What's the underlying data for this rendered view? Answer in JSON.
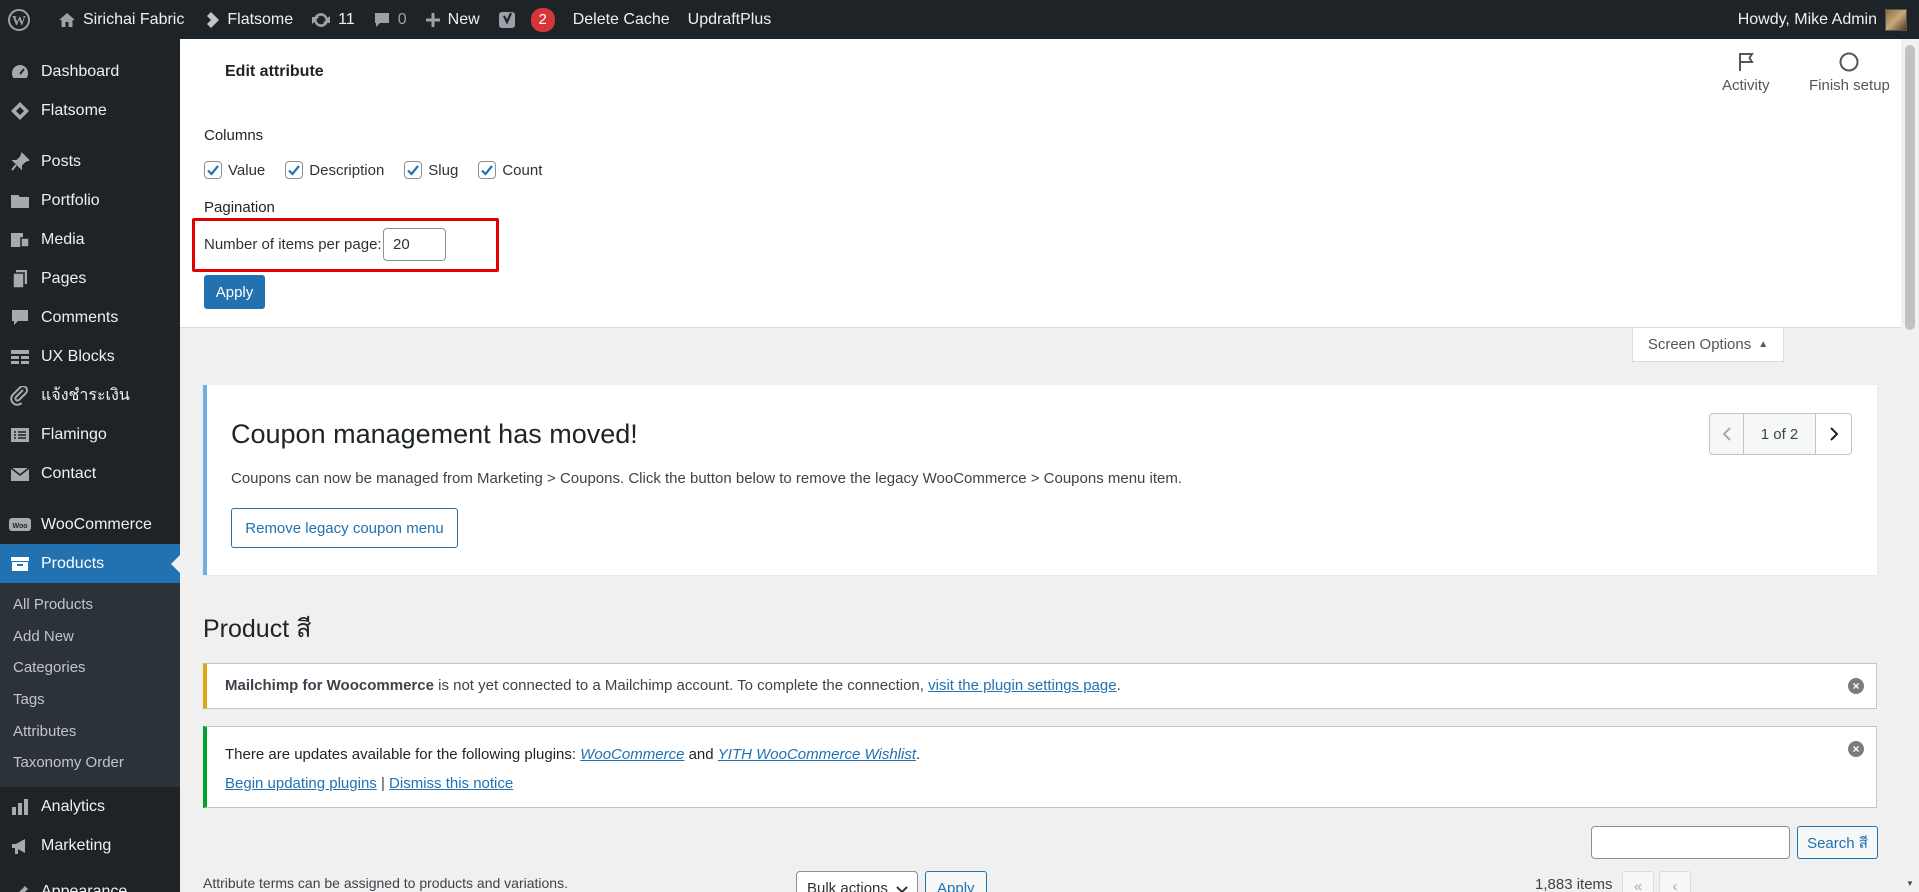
{
  "adminbar": {
    "site_name": "Sirichai Fabric",
    "theme": "Flatsome",
    "updates_count": "11",
    "comments_count": "0",
    "new_label": "New",
    "yoast_badge": "2",
    "delete_cache": "Delete Cache",
    "updraft": "UpdraftPlus",
    "howdy": "Howdy, Mike Admin"
  },
  "sidebar": {
    "items": [
      {
        "label": "Dashboard",
        "icon": "dashboard-icon"
      },
      {
        "label": "Flatsome",
        "icon": "flatsome-icon"
      },
      {
        "label": "Posts",
        "icon": "pin-icon"
      },
      {
        "label": "Portfolio",
        "icon": "folder-icon"
      },
      {
        "label": "Media",
        "icon": "media-icon"
      },
      {
        "label": "Pages",
        "icon": "pages-icon"
      },
      {
        "label": "Comments",
        "icon": "comment-icon"
      },
      {
        "label": "UX Blocks",
        "icon": "grid-icon"
      },
      {
        "label": "แจ้งชำระเงิน",
        "icon": "paperclip-icon"
      },
      {
        "label": "Flamingo",
        "icon": "list-icon"
      },
      {
        "label": "Contact",
        "icon": "mail-icon"
      },
      {
        "label": "WooCommerce",
        "icon": "woo-icon"
      },
      {
        "label": "Products",
        "icon": "archive-icon"
      },
      {
        "label": "Analytics",
        "icon": "bar-chart-icon"
      },
      {
        "label": "Marketing",
        "icon": "megaphone-icon"
      },
      {
        "label": "Appearance",
        "icon": "brush-icon"
      }
    ],
    "submenu": [
      "All Products",
      "Add New",
      "Categories",
      "Tags",
      "Attributes",
      "Taxonomy Order"
    ]
  },
  "header": {
    "title": "Edit attribute",
    "activity": "Activity",
    "finish_setup": "Finish setup"
  },
  "screen_options": {
    "columns_legend": "Columns",
    "columns": [
      "Value",
      "Description",
      "Slug",
      "Count"
    ],
    "pagination_legend": "Pagination",
    "per_page_label": "Number of items per page:",
    "per_page_value": "20",
    "apply": "Apply",
    "tab_label": "Screen Options"
  },
  "coupon_notice": {
    "title": "Coupon management has moved!",
    "text": "Coupons can now be managed from Marketing > Coupons. Click the button below to remove the legacy WooCommerce > Coupons menu item.",
    "button": "Remove legacy coupon menu",
    "pager": "1 of 2"
  },
  "page_title": "Product สี",
  "mailchimp_notice": {
    "bold": "Mailchimp for Woocommerce",
    "text": " is not yet connected to a Mailchimp account. To complete the connection, ",
    "link": "visit the plugin settings page",
    "end": "."
  },
  "updates_notice": {
    "text": "There are updates available for the following plugins: ",
    "link1": "WooCommerce",
    "and": " and ",
    "link2": "YITH WooCommerce Wishlist",
    "end": ".",
    "begin": "Begin updating plugins",
    "sep": " | ",
    "dismiss": "Dismiss this notice"
  },
  "search": {
    "button": "Search สี",
    "value": ""
  },
  "table_nav": {
    "description": "Attribute terms can be assigned to products and variations.",
    "bulk_actions": "Bulk actions",
    "apply": "Apply",
    "items": "1,883 items",
    "first": "«",
    "prev": "‹"
  },
  "colors": {
    "adminbar_bg": "#1d2327",
    "accent": "#2271b1",
    "highlight_box": "#e00000",
    "warning": "#dba617",
    "success": "#00a32a",
    "info": "#72aee6"
  }
}
